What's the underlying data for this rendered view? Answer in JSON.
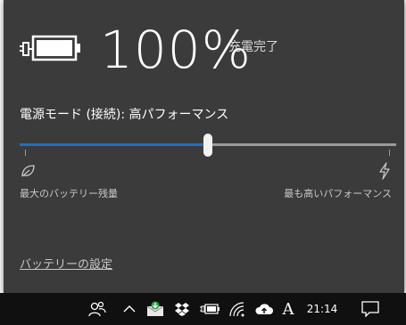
{
  "flyout": {
    "percent": "100%",
    "charge_status": "充電完了",
    "power_mode_label": "電源モード (接続): 高パフォーマンス",
    "slider": {
      "level": 0.5,
      "min_label": "最大のバッテリー残量",
      "max_label": "最も高いパフォーマンス"
    },
    "settings_link": "バッテリーの設定"
  },
  "taskbar": {
    "clock": "21:14",
    "ime_indicator": "A",
    "icons": [
      "people-icon",
      "chevron-up-icon",
      "mail-download-icon",
      "dropbox-icon",
      "battery-icon",
      "wifi-icon",
      "onedrive-icon",
      "ime-icon",
      "notification-icon"
    ]
  },
  "colors": {
    "flyout_bg": "#3b3b3b",
    "accent": "#1e6fc6",
    "taskbar_bg": "#101010"
  }
}
